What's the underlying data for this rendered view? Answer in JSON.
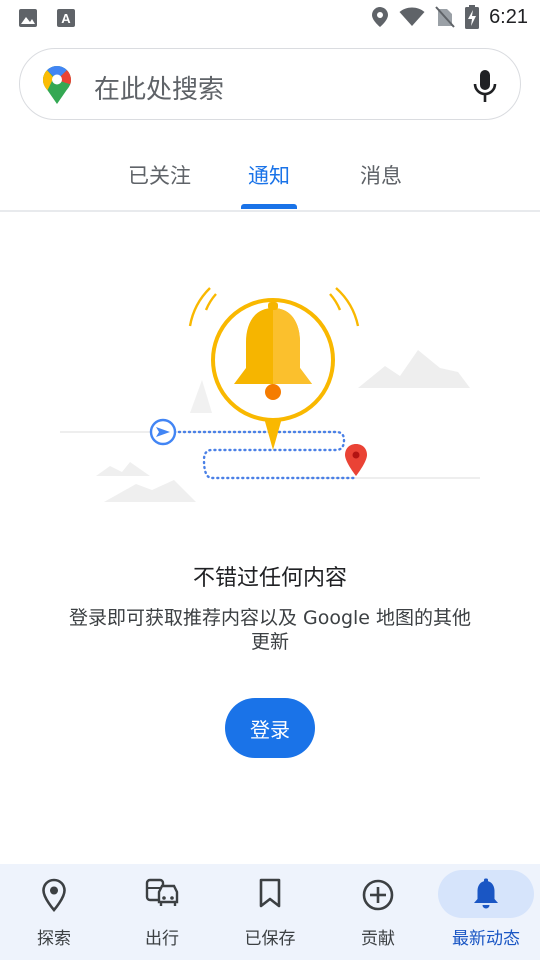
{
  "status_bar": {
    "time": "6:21",
    "icons": [
      "image-icon",
      "a-icon",
      "location-icon",
      "wifi-icon",
      "no-sim-icon",
      "battery-charging-icon"
    ]
  },
  "search": {
    "placeholder": "在此处搜索",
    "icons": [
      "google-maps-logo",
      "mic-icon"
    ]
  },
  "tabs": [
    {
      "label": "已关注",
      "active": false
    },
    {
      "label": "通知",
      "active": true
    },
    {
      "label": "消息",
      "active": false
    }
  ],
  "empty_state": {
    "title": "不错过任何内容",
    "description": "登录即可获取推荐内容以及 Google 地图的其他更新",
    "button_label": "登录",
    "illustration": "bell-notification-illustration"
  },
  "bottom_nav": [
    {
      "label": "探索",
      "icon": "location-pin-icon",
      "active": false
    },
    {
      "label": "出行",
      "icon": "commute-icon",
      "active": false
    },
    {
      "label": "已保存",
      "icon": "bookmark-icon",
      "active": false
    },
    {
      "label": "贡献",
      "icon": "add-circle-icon",
      "active": false
    },
    {
      "label": "最新动态",
      "icon": "bell-icon",
      "active": true
    }
  ],
  "colors": {
    "accent": "#1a73e8",
    "nav_background": "#eef3fc",
    "bell_yellow": "#f9b800",
    "pin_red": "#ea4335"
  }
}
